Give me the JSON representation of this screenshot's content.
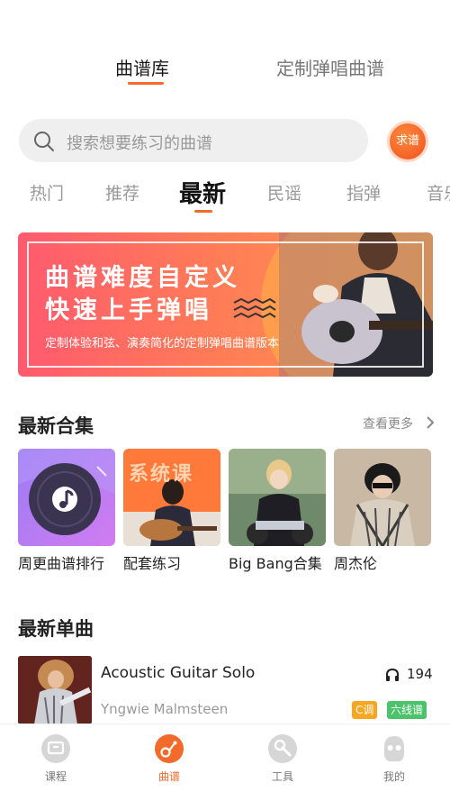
{
  "header": {
    "tabs": [
      {
        "label": "曲谱库",
        "active": true
      },
      {
        "label": "定制弹唱曲谱",
        "active": false
      }
    ]
  },
  "search": {
    "placeholder": "搜索想要练习的曲谱",
    "request_button": "求谱"
  },
  "categories": {
    "items": [
      "热门",
      "推荐",
      "最新",
      "民谣",
      "指弹",
      "音乐"
    ],
    "active": "最新"
  },
  "banner": {
    "title_line1": "曲谱难度自定义",
    "title_line2": "快速上手弹唱",
    "subtitle": "定制体验和弦、演奏简化的定制弹唱曲谱版本"
  },
  "collections": {
    "title": "最新合集",
    "more_label": "查看更多",
    "items": [
      {
        "name": "周更曲谱排行"
      },
      {
        "name": "配套练习",
        "cover_text": "系统课"
      },
      {
        "name": "Big Bang合集"
      },
      {
        "name": "周杰伦"
      }
    ]
  },
  "singles": {
    "title": "最新单曲",
    "items": [
      {
        "title": "Acoustic Guitar Solo",
        "artist": "Yngwie Malmsteen",
        "plays": "194",
        "key_tag": "C调",
        "type_tag": "六线谱"
      }
    ]
  },
  "bottom_nav": {
    "items": [
      {
        "label": "课程",
        "icon": "course-icon",
        "active": false
      },
      {
        "label": "曲谱",
        "icon": "score-icon",
        "active": true
      },
      {
        "label": "工具",
        "icon": "tools-icon",
        "active": false
      },
      {
        "label": "我的",
        "icon": "profile-icon",
        "active": false
      }
    ]
  },
  "colors": {
    "accent": "#f26b2a",
    "tag_key": "#f5a623",
    "tag_type": "#4cc36a"
  }
}
